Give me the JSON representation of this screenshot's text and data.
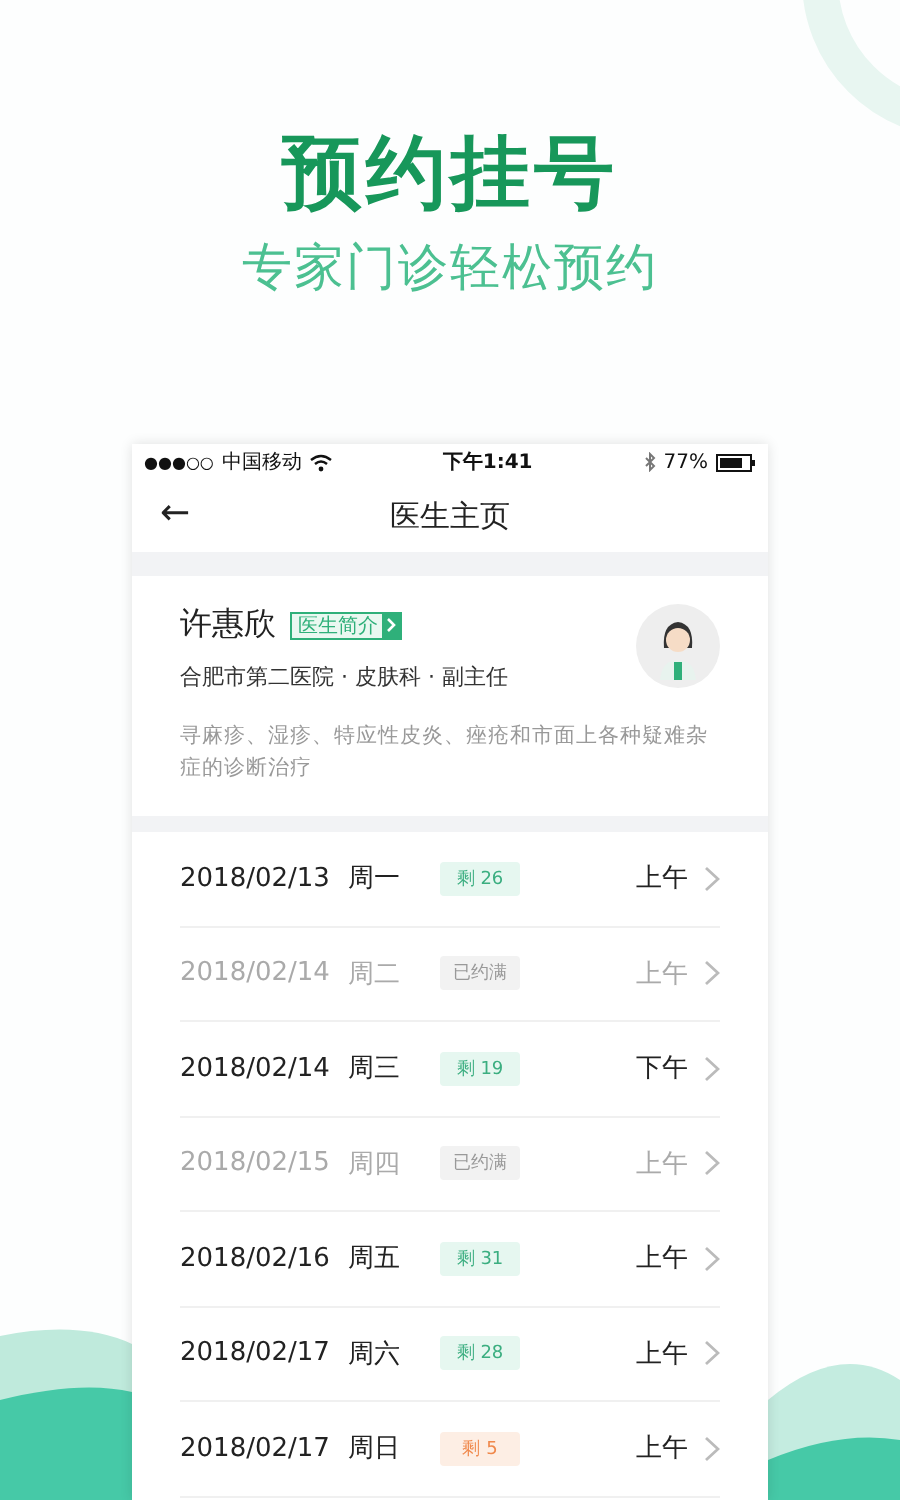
{
  "promo": {
    "headline": "预约挂号",
    "subtitle": "专家门诊轻松预约"
  },
  "status_bar": {
    "signal": "●●●○○",
    "carrier": "中国移动",
    "time": "下午1:41",
    "battery": "77%"
  },
  "nav": {
    "back": "←",
    "title": "医生主页"
  },
  "doctor": {
    "name": "许惠欣",
    "intro_tag": "医生简介",
    "affiliation": "合肥市第二医院 · 皮肤科 · 副主任",
    "specialty": "寻麻疹、湿疹、特应性皮炎、痤疮和市面上各种疑难杂症的诊断治疗"
  },
  "schedule": [
    {
      "date": "2018/02/13",
      "weekday": "周一",
      "kind": "available",
      "badge": "剩 26",
      "period": "上午"
    },
    {
      "date": "2018/02/14",
      "weekday": "周二",
      "kind": "full",
      "badge": "已约满",
      "period": "上午"
    },
    {
      "date": "2018/02/14",
      "weekday": "周三",
      "kind": "available",
      "badge": "剩 19",
      "period": "下午"
    },
    {
      "date": "2018/02/15",
      "weekday": "周四",
      "kind": "full",
      "badge": "已约满",
      "period": "上午"
    },
    {
      "date": "2018/02/16",
      "weekday": "周五",
      "kind": "available",
      "badge": "剩 31",
      "period": "上午"
    },
    {
      "date": "2018/02/17",
      "weekday": "周六",
      "kind": "available",
      "badge": "剩 28",
      "period": "上午"
    },
    {
      "date": "2018/02/17",
      "weekday": "周日",
      "kind": "few",
      "badge": "剩 5",
      "period": "上午"
    }
  ]
}
